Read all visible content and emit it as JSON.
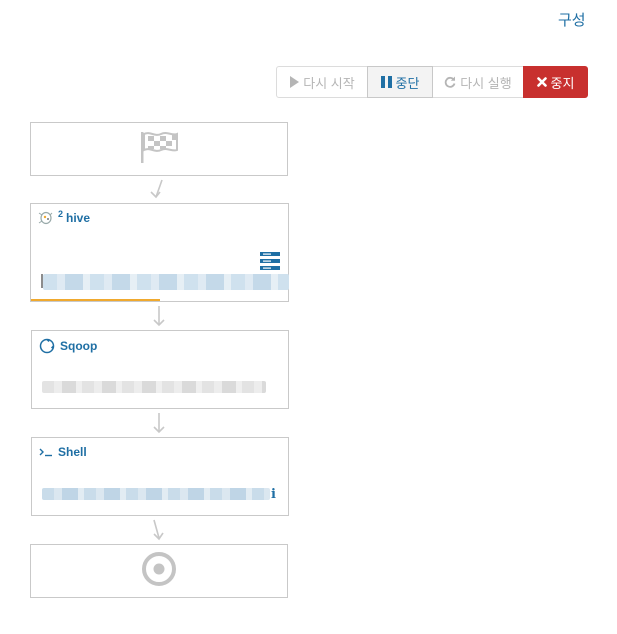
{
  "header": {
    "config_label": "구성"
  },
  "toolbar": {
    "rerun_label": "다시 시작",
    "stop_label": "중단",
    "resume_label": "다시 실행",
    "kill_label": "중지"
  },
  "workflow": {
    "nodes": [
      {
        "type": "start",
        "icon": "flag-icon"
      },
      {
        "type": "action",
        "name": "hive",
        "icon": "hive-icon",
        "badge": "2",
        "progress": 0.5
      },
      {
        "type": "action",
        "name": "Sqoop",
        "icon": "sqoop-icon"
      },
      {
        "type": "action",
        "name": "Shell",
        "icon": "terminal-icon"
      },
      {
        "type": "end",
        "icon": "target-icon"
      }
    ]
  },
  "colors": {
    "accent": "#1f6fa4",
    "danger": "#c8302e",
    "progress": "#f0a92e",
    "border": "#c9c9c9"
  }
}
